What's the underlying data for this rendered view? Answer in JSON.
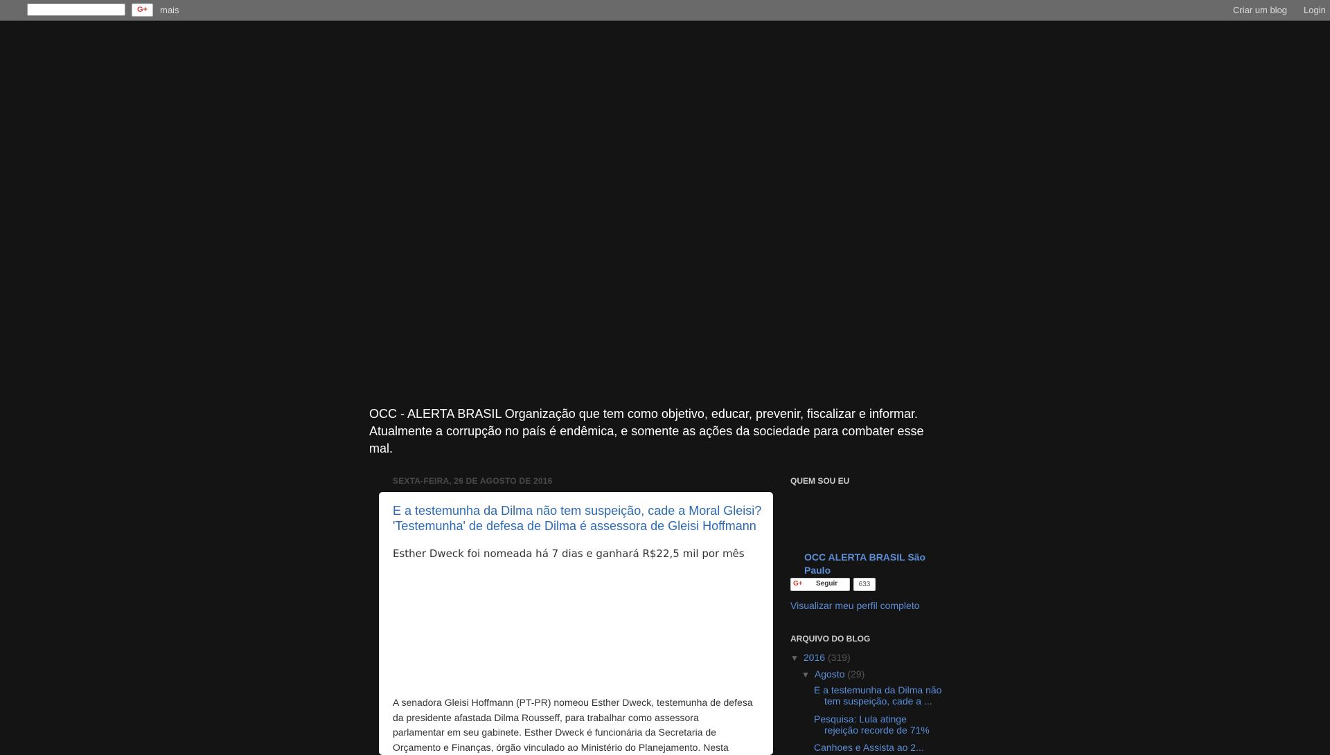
{
  "navbar": {
    "search_value": "",
    "gplus_label": "G+",
    "more_label": "mais",
    "create_blog_label": "Criar um blog",
    "login_label": "Login"
  },
  "header": {
    "description": "OCC - ALERTA BRASIL Organização que tem como objetivo, educar, prevenir, fiscalizar e informar. Atualmente a corrupção no país é endêmica, e somente as ações da sociedade para combater esse mal."
  },
  "post": {
    "date": "sexta-feira, 26 de agosto de 2016",
    "title": "E a testemunha da Dilma não tem suspeição, cade a Moral Gleisi? 'Testemunha' de defesa de Dilma é assessora de Gleisi Hoffmann",
    "subtitle": "Esther Dweck foi nomeada há 7 dias e ganhará R$22,5 mil por mês",
    "body": " A senadora Gleisi Hoffmann (PT-PR) nomeou Esther Dweck, testemunha de defesa da presidente afastada Dilma Rousseff, para trabalhar como assessora parlamentar em seu gabinete. Esther Dweck é funcionária da Secretaria de Orçamento e Finanças, órgão vinculado ao Ministério do Planejamento. Nesta"
  },
  "sidebar": {
    "about": {
      "heading": "Quem sou eu",
      "name": "OCC ALERTA BRASIL São Paulo",
      "follow_icon": "G+",
      "follow_label": "Seguir",
      "follow_count": "633",
      "profile_link": "Visualizar meu perfil completo"
    },
    "archive": {
      "heading": "Arquivo do blog",
      "year": {
        "toggle": "▼",
        "label": "2016",
        "count": "(319)"
      },
      "month": {
        "toggle": "▼",
        "label": "Agosto",
        "count": "(29)"
      },
      "posts": [
        "E a testemunha da Dilma não tem suspeição, cade a ...",
        "Pesquisa: Lula atinge rejeição recorde de 71%",
        "Canhoes e Assista ao 2..."
      ]
    }
  },
  "colors": {
    "background": "#141414",
    "navbar": "#6a6a6a",
    "link": "#5b8ed6",
    "title": "#2e6ab4",
    "gplus": "#d73d32"
  }
}
